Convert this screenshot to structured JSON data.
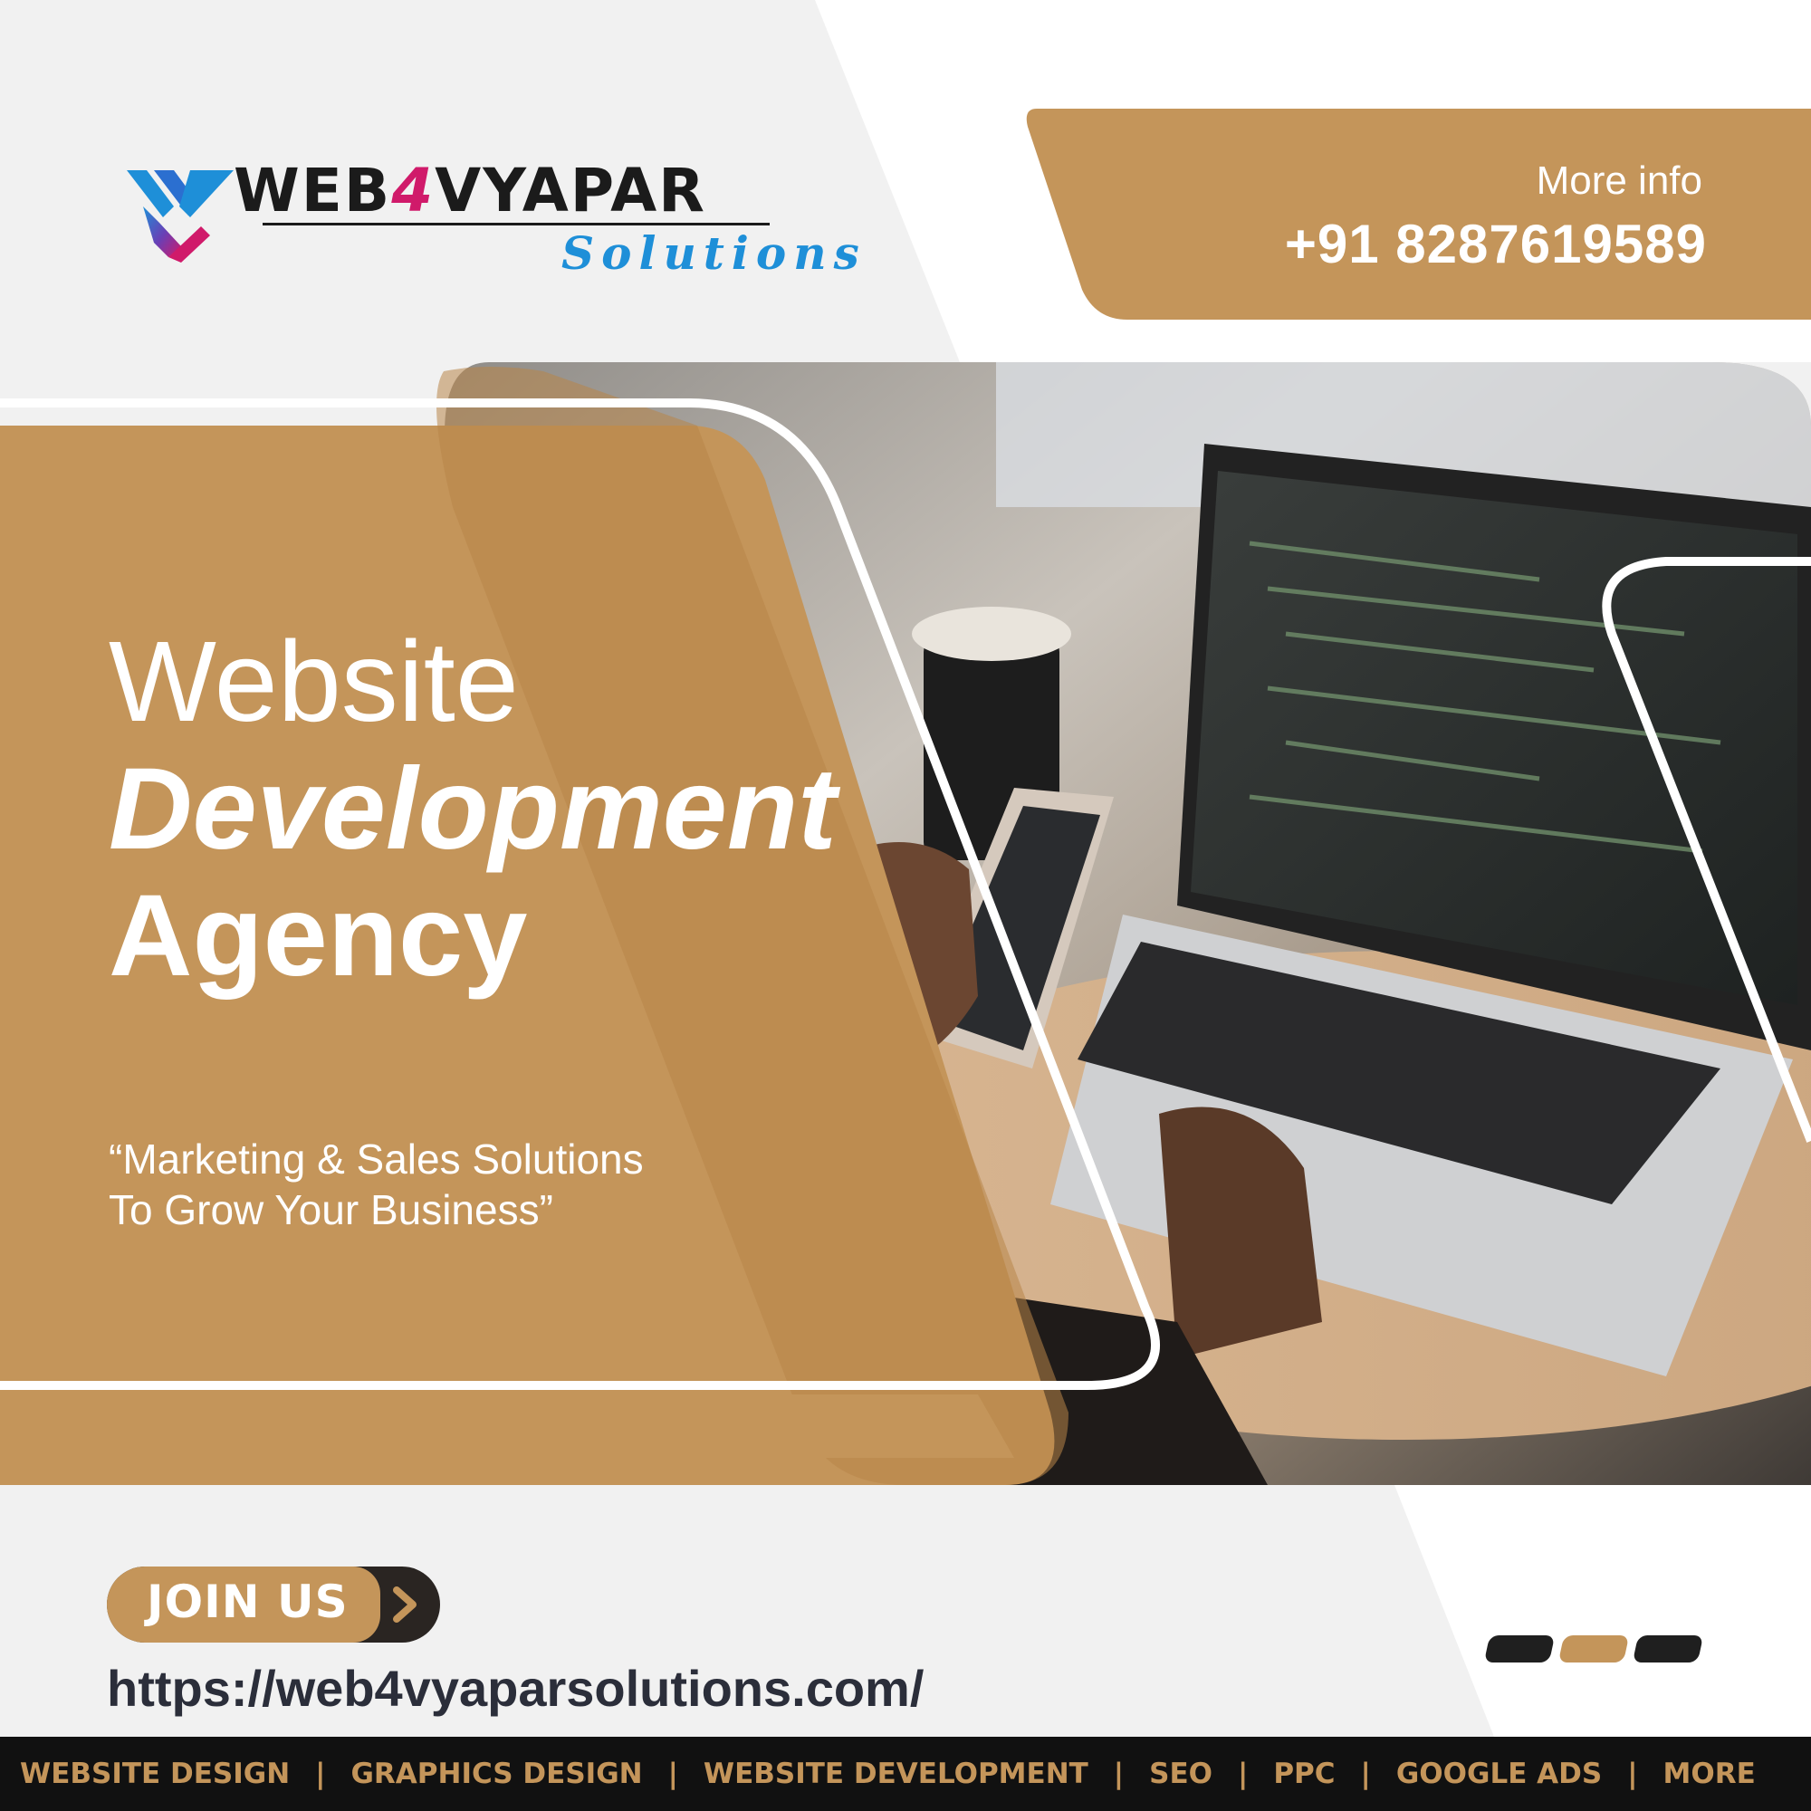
{
  "brand": {
    "name_part1": "WEB",
    "name_digit": "4",
    "name_part2": "VYAPAR",
    "subtitle": "Solutions",
    "logo_icon": "wv-monogram-icon"
  },
  "contact": {
    "label": "More info",
    "phone": "+91 8287619589"
  },
  "hero": {
    "line1": "Website",
    "line2": "Development",
    "line3": "Agency",
    "tagline_line1": "“Marketing & Sales Solutions",
    "tagline_line2": "To Grow Your Business”",
    "photo_description_icon": "laptop-phone-photo"
  },
  "cta": {
    "label": "JOIN US",
    "arrow_icon": "chevron-right-icon"
  },
  "website": "https://web4vyaparsolutions.com/",
  "services": [
    "WEBSITE DESIGN",
    "GRAPHICS DESIGN",
    "WEBSITE DEVELOPMENT",
    "SEO",
    "PPC",
    "GOOGLE ADS",
    "MORE"
  ],
  "colors": {
    "accent": "#c4955a",
    "dark": "#2a2522",
    "background": "#f1f1f1",
    "nav_bg": "#111111",
    "logo_pink": "#d01a6a",
    "logo_blue": "#1e8fd8"
  }
}
